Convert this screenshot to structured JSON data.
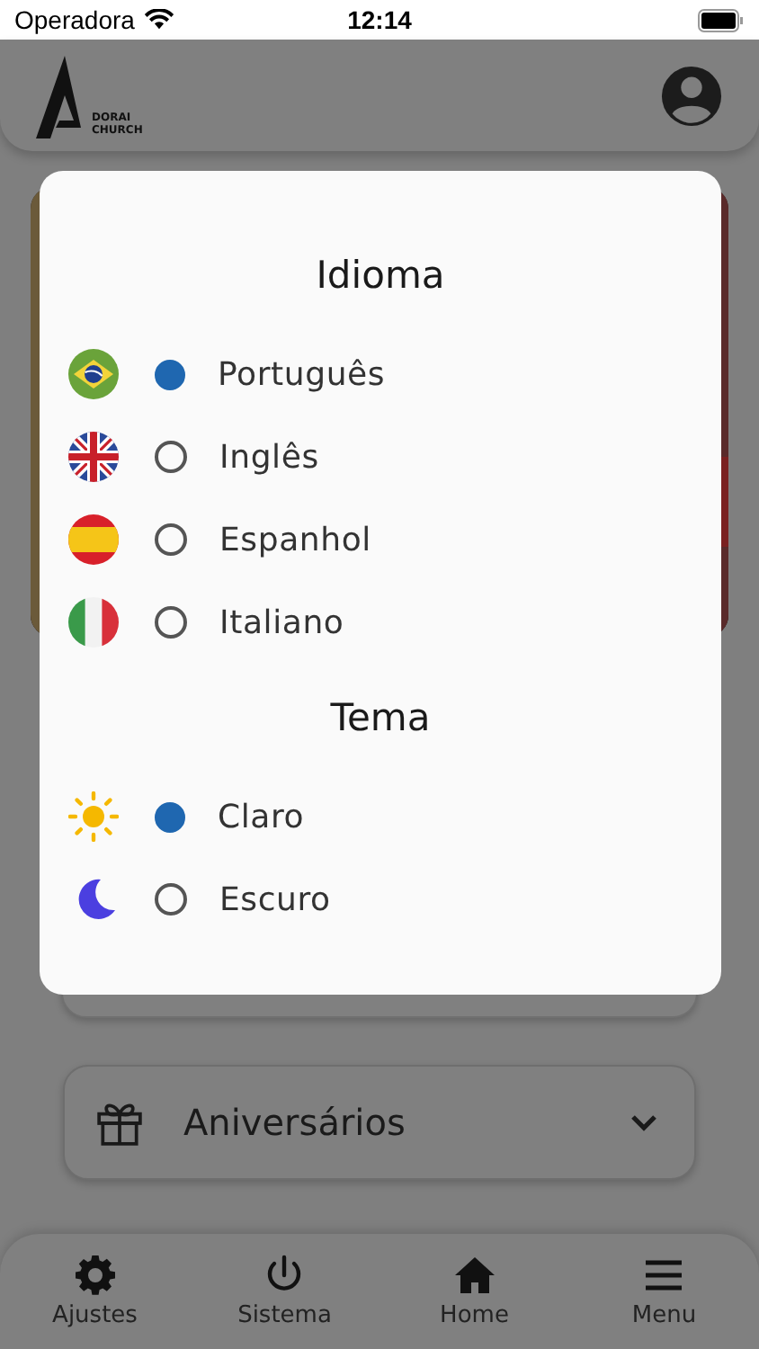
{
  "status_bar": {
    "carrier": "Operadora",
    "time": "12:14"
  },
  "header": {
    "logo_text": [
      "DORAI",
      "CHURCH"
    ]
  },
  "birthdays": {
    "label": "Aniversários",
    "expanded": false
  },
  "dialog": {
    "sections": [
      {
        "title": "Idioma",
        "options": [
          {
            "label": "Português",
            "kind": "brazil",
            "selected": true
          },
          {
            "label": "Inglês",
            "kind": "uk",
            "selected": false
          },
          {
            "label": "Espanhol",
            "kind": "spain",
            "selected": false
          },
          {
            "label": "Italiano",
            "kind": "italy",
            "selected": false
          }
        ]
      },
      {
        "title": "Tema",
        "options": [
          {
            "label": "Claro",
            "kind": "sun",
            "selected": true
          },
          {
            "label": "Escuro",
            "kind": "moon",
            "selected": false
          }
        ]
      }
    ]
  },
  "bottom_nav": [
    {
      "label": "Ajustes",
      "kind": "gear"
    },
    {
      "label": "Sistema",
      "kind": "power"
    },
    {
      "label": "Home",
      "kind": "home"
    },
    {
      "label": "Menu",
      "kind": "menu"
    }
  ]
}
